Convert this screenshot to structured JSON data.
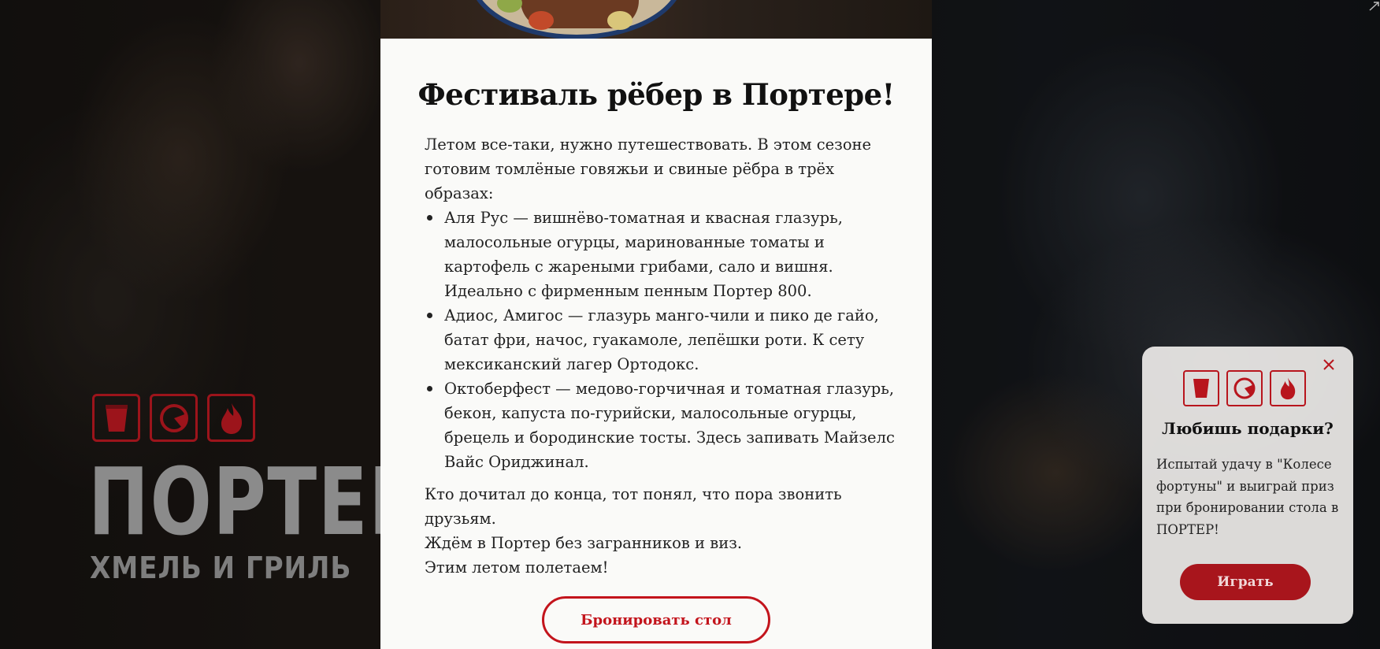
{
  "brand": {
    "name": "ПОРТЕР",
    "tagline": "ХМЕЛЬ И ГРИЛЬ",
    "icons": [
      "glass-icon",
      "grill-meter-icon",
      "flame-icon"
    ],
    "accent_color": "#c3141c"
  },
  "modal": {
    "title": "Фестиваль рёбер в Портере!",
    "intro": "Летом все-таки, нужно путешествовать. В этом сезоне готовим томлёные говяжьи и свиные рёбра в трёх образах:",
    "items": [
      "Аля Рус — вишнёво-томатная и квасная глазурь, малосольные огурцы, маринованные томаты и картофель с жареными грибами, сало и вишня. Идеально с фирменным пенным Портер 800.",
      "Адиос, Амигос — глазурь манго-чили и пико де гайо, батат фри, начос, гуакамоле, лепёшки роти. К сету мексиканский лагер Ортодокс.",
      "Октоберфест — медово-горчичная и томатная глазурь, бекон, капуста по-гурийски, малосольные огурцы, брецель и бородинские тосты. Здесь запивать Майзелс Вайс Ориджинал."
    ],
    "closing": [
      "Кто дочитал до конца, тот понял, что пора звонить друзьям.",
      "Ждём в Портер без загранников и виз.",
      "Этим летом полетаем!"
    ],
    "book_button": "Бронировать стол"
  },
  "gift_popup": {
    "title": "Любишь подарки?",
    "text": "Испытай удачу в \"Колесе фортуны\" и выиграй приз при бронировании стола в ПОРТЕР!",
    "play_button": "Играть"
  }
}
